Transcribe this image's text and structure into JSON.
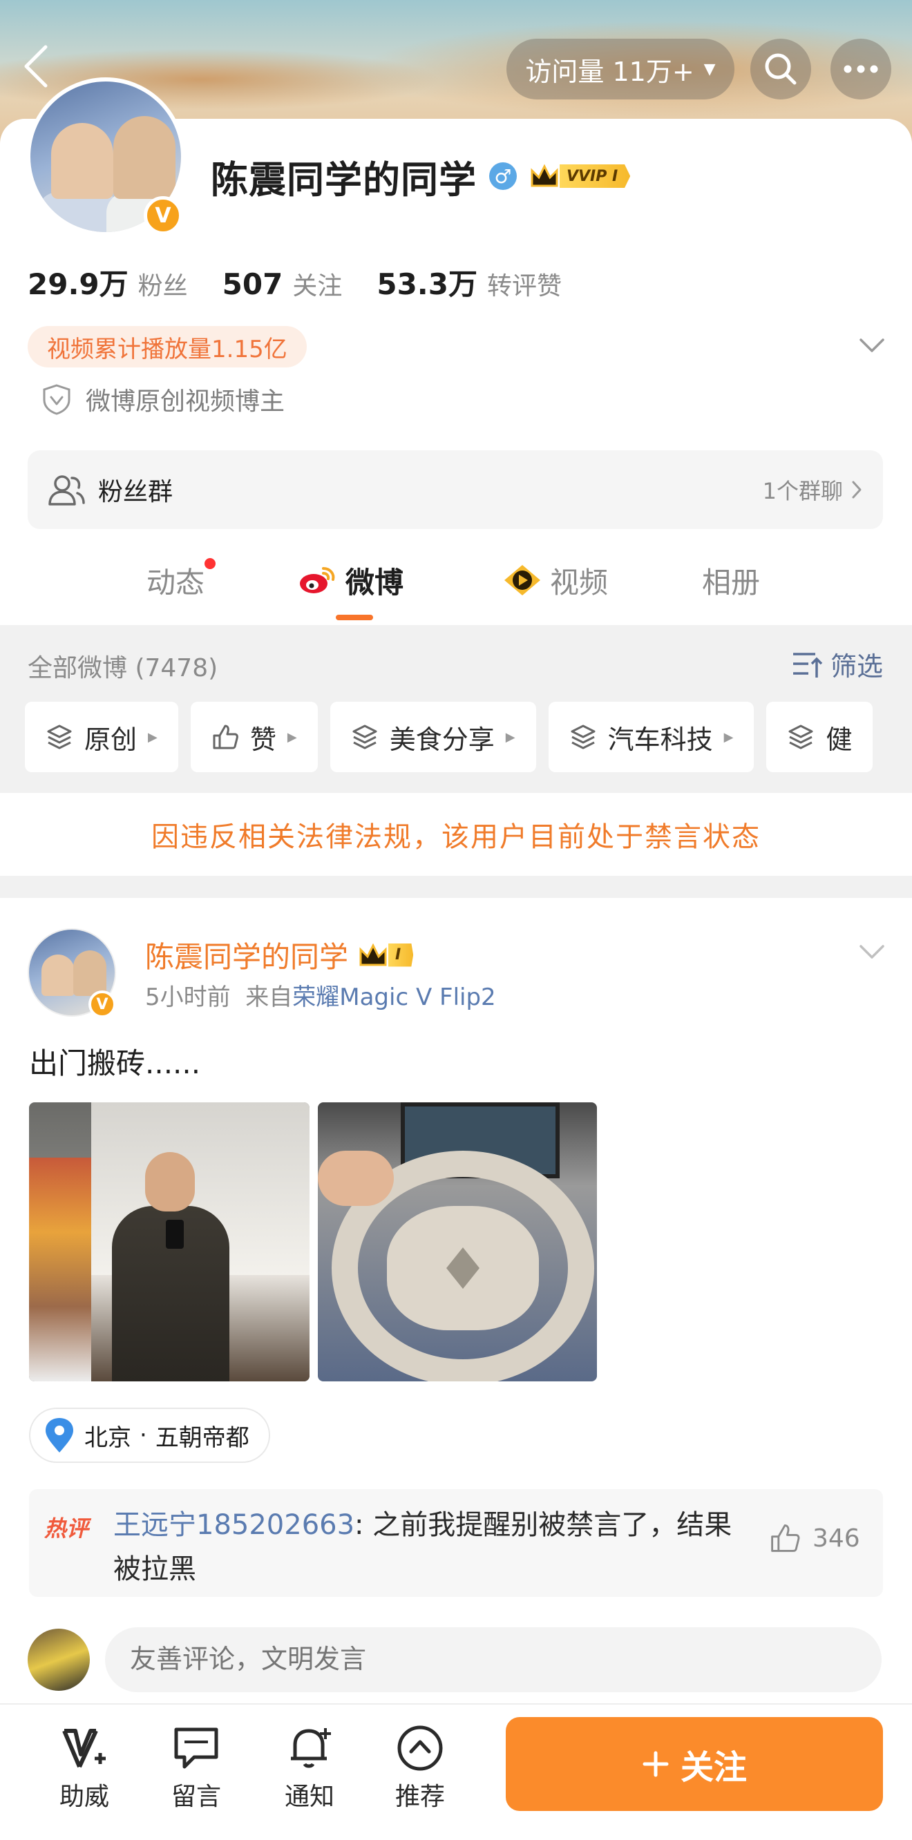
{
  "header": {
    "visits_label": "访问量 11万+"
  },
  "profile": {
    "name": "陈震同学的同学",
    "vip_tag": "VVIP I",
    "stats": [
      {
        "num": "29.9万",
        "label": "粉丝"
      },
      {
        "num": "507",
        "label": "关注"
      },
      {
        "num": "53.3万",
        "label": "转评赞"
      }
    ],
    "play_count": "视频累计播放量1.15亿",
    "certification": "微博原创视频博主",
    "fans_group": {
      "label": "粉丝群",
      "count": "1个群聊"
    }
  },
  "tabs": [
    {
      "label": "动态"
    },
    {
      "label": "微博"
    },
    {
      "label": "视频"
    },
    {
      "label": "相册"
    }
  ],
  "feed": {
    "all_label": "全部微博 (7478)",
    "filter_label": "筛选",
    "chips": [
      "原创",
      "赞",
      "美食分享",
      "汽车科技",
      "健"
    ],
    "notice": "因违反相关法律法规，该用户目前处于禁言状态"
  },
  "post": {
    "author": "陈震同学的同学",
    "vip_level": "I",
    "time": "5小时前",
    "from_prefix": "来自",
    "source": "荣耀Magic V Flip2",
    "text": "出门搬砖......",
    "location_city": "北京",
    "location_sep": "·",
    "location_area": "五朝帝都",
    "hot_comment": {
      "tag": "热评",
      "user": "王远宁185202663",
      "text": ": 之前我提醒别被禁言了，结果被拉黑",
      "likes": "346"
    },
    "comment_placeholder": "友善评论，文明发言"
  },
  "bottom_bar": {
    "items": [
      "助威",
      "留言",
      "通知",
      "推荐"
    ],
    "follow_label": "关注"
  },
  "colors": {
    "accent_orange": "#fb8b2b",
    "link_blue": "#5a7bb0",
    "notice_orange": "#f07b2a"
  }
}
